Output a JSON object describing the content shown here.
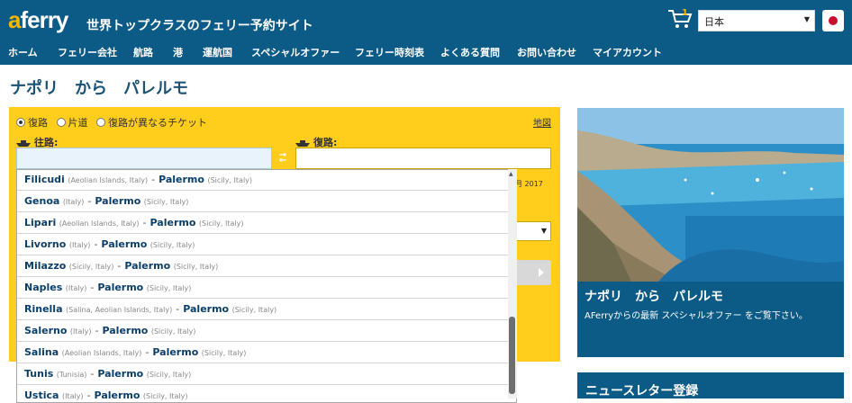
{
  "header": {
    "logo_a": "a",
    "logo_rest": "ferry",
    "tagline": "世界トップクラスのフェリー予約サイト",
    "cart_count": "1",
    "language_selected": "日本",
    "flag_icon": "japan-flag-icon",
    "brand_color": "#0c5a86",
    "logo_accent": "#f5b800"
  },
  "nav": {
    "items": [
      {
        "label": "ホーム"
      },
      {
        "label": "フェリー会社"
      },
      {
        "label": "航路"
      },
      {
        "label": "港"
      },
      {
        "label": "運航国"
      },
      {
        "label": "スペシャルオファー"
      },
      {
        "label": "フェリー時刻表"
      },
      {
        "label": "よくある質問"
      },
      {
        "label": "お問い合わせ"
      },
      {
        "label": "マイアカウント"
      }
    ]
  },
  "page": {
    "title": "ナポリ　から　パレルモ"
  },
  "booking": {
    "accent_color": "#ffcd1c",
    "trip_types": [
      {
        "label": "復路",
        "selected": true
      },
      {
        "label": "片道",
        "selected": false
      },
      {
        "label": "復路が異なるチケット",
        "selected": false
      }
    ],
    "map_link": "地図",
    "outbound_label": "往路:",
    "return_label": "復路:",
    "outbound_value": "",
    "return_value": "",
    "partial_date": "月 2017"
  },
  "dropdown": {
    "items": [
      {
        "port": "Filicudi",
        "region": "(Aeolian Islands, Italy)",
        "dest": "Palermo",
        "dest_region": "(Sicily, Italy)"
      },
      {
        "port": "Genoa",
        "region": "(Italy)",
        "dest": "Palermo",
        "dest_region": "(Sicily, Italy)"
      },
      {
        "port": "Lipari",
        "region": "(Aeolian Islands, Italy)",
        "dest": "Palermo",
        "dest_region": "(Sicily, Italy)"
      },
      {
        "port": "Livorno",
        "region": "(Italy)",
        "dest": "Palermo",
        "dest_region": "(Sicily, Italy)"
      },
      {
        "port": "Milazzo",
        "region": "(Sicily, Italy)",
        "dest": "Palermo",
        "dest_region": "(Sicily, Italy)"
      },
      {
        "port": "Naples",
        "region": "(Italy)",
        "dest": "Palermo",
        "dest_region": "(Sicily, Italy)"
      },
      {
        "port": "Rinella",
        "region": "(Salina, Aeolian Islands, Italy)",
        "dest": "Palermo",
        "dest_region": "(Sicily, Italy)"
      },
      {
        "port": "Salerno",
        "region": "(Italy)",
        "dest": "Palermo",
        "dest_region": "(Sicily, Italy)"
      },
      {
        "port": "Salina",
        "region": "(Aeolian Islands, Italy)",
        "dest": "Palermo",
        "dest_region": "(Sicily, Italy)"
      },
      {
        "port": "Tunis",
        "region": "(Tunisia)",
        "dest": "Palermo",
        "dest_region": "(Sicily, Italy)"
      },
      {
        "port": "Ustica",
        "region": "(Italy)",
        "dest": "Palermo",
        "dest_region": "(Sicily, Italy)"
      }
    ]
  },
  "promo": {
    "title": "ナポリ　から　パレルモ",
    "subtitle": "AFerryからの最新 スペシャルオファー をご覧下さい。"
  },
  "newsletter": {
    "title": "ニュースレター登録"
  }
}
